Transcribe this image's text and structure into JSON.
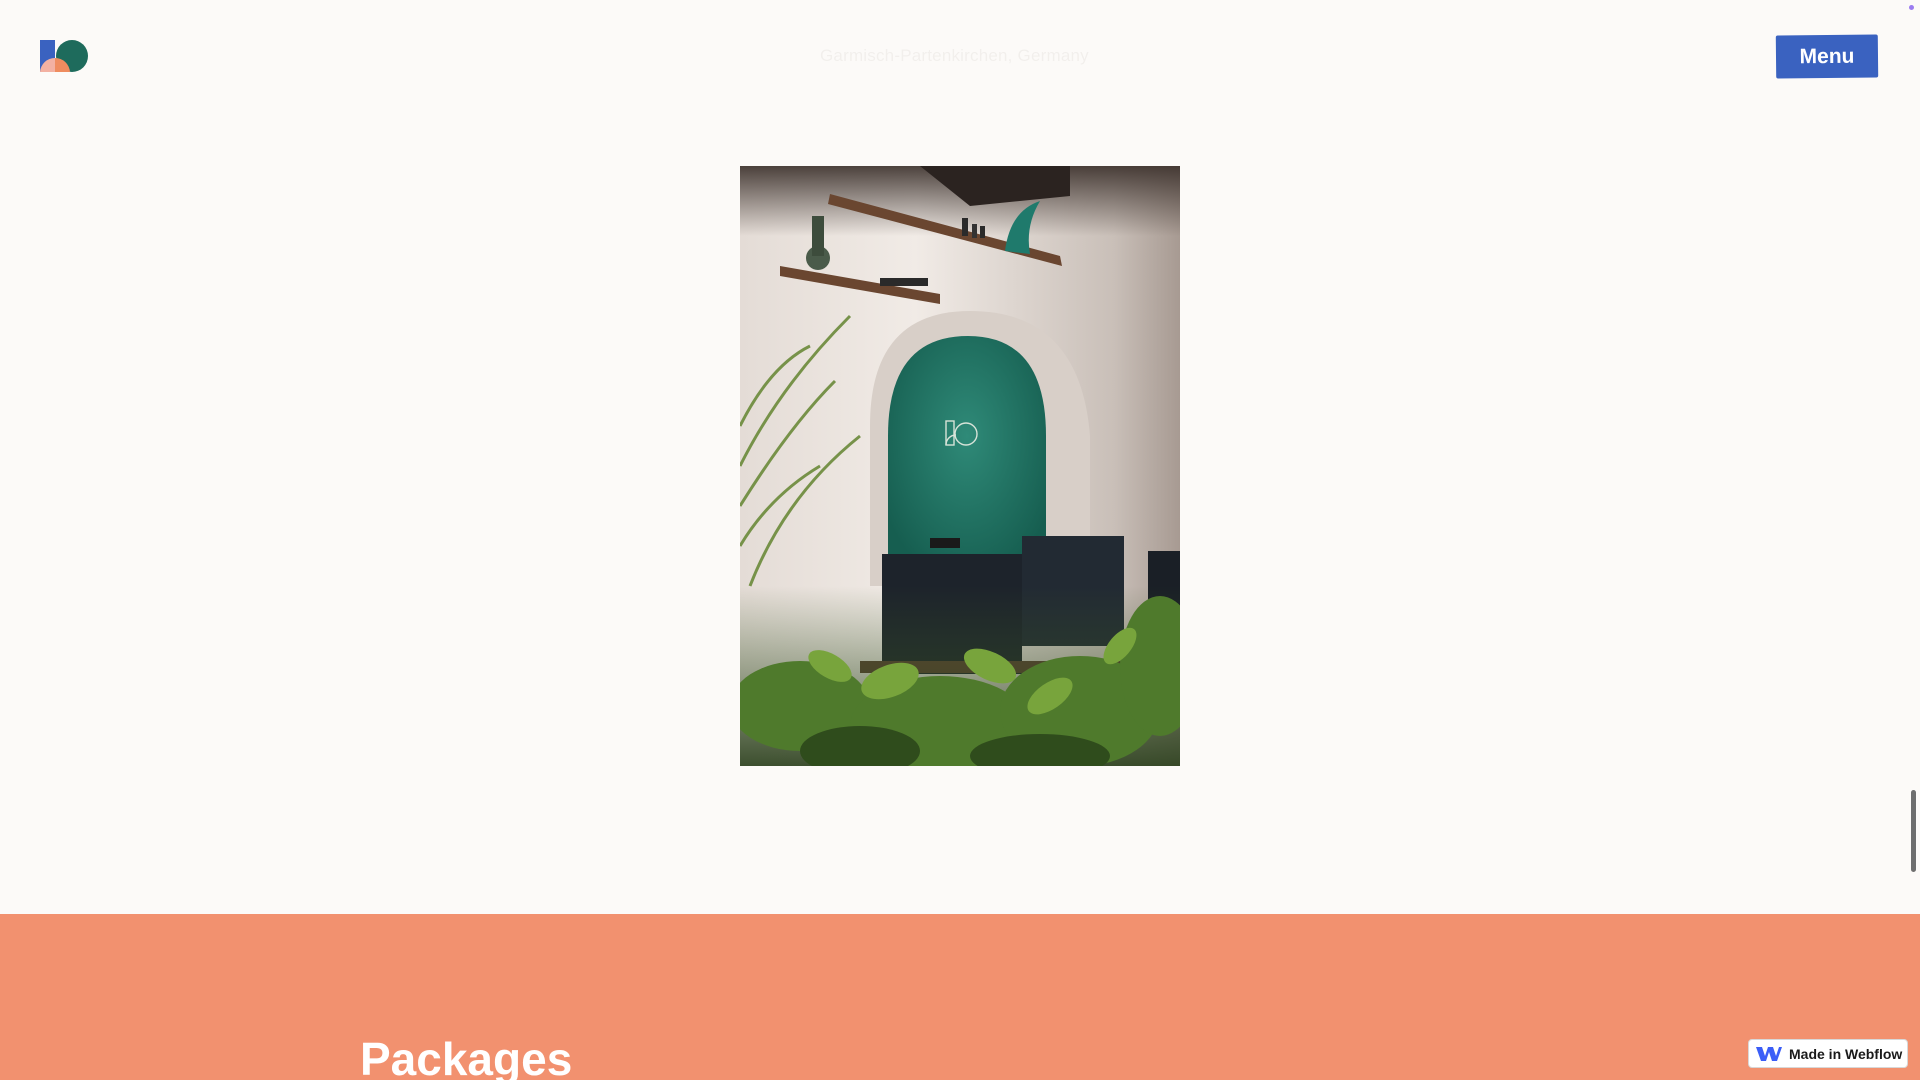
{
  "header": {
    "logo_icon": "brand-logo-icon",
    "location": "Garmisch-Partenkirchen, Germany",
    "menu_label": "Menu"
  },
  "photo": {
    "icon": "office-arch-photo"
  },
  "packages": {
    "title": "Packages"
  },
  "badge": {
    "label": "Made in Webflow",
    "icon": "webflow-icon"
  },
  "colors": {
    "page_background": "#fcfaf8",
    "menu_button": "#3a62c0",
    "packages_background": "#f2916f",
    "logo_blue": "#3a62c0",
    "logo_green": "#1e6b5c",
    "logo_pink": "#f3b1a2",
    "logo_orange": "#ef8c5f"
  }
}
